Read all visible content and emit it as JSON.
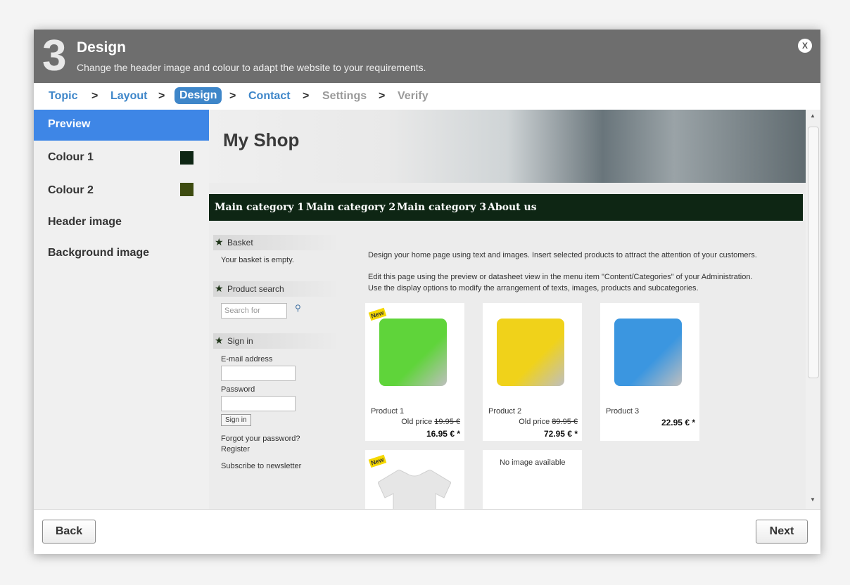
{
  "header": {
    "step_number": "3",
    "title": "Design",
    "subtitle": "Change the header image and colour to adapt the website to your requirements.",
    "close_label": "X"
  },
  "breadcrumb": {
    "steps": [
      "Topic",
      "Layout",
      "Design",
      "Contact",
      "Settings",
      "Verify"
    ],
    "separator": ">"
  },
  "sidebar": {
    "items": [
      {
        "label": "Preview",
        "active": true
      },
      {
        "label": "Colour 1",
        "swatch": "#0e2614"
      },
      {
        "label": "Colour 2",
        "swatch": "#3d4b10"
      },
      {
        "label": "Header image"
      },
      {
        "label": "Background image"
      }
    ]
  },
  "preview": {
    "shop_title": "My Shop",
    "nav": [
      "Main category 1",
      "Main category 2",
      "Main category 3",
      "About us"
    ],
    "basket": {
      "heading": "Basket",
      "text": "Your basket is empty."
    },
    "search": {
      "heading": "Product search",
      "placeholder": "Search for"
    },
    "signin": {
      "heading": "Sign in",
      "email_label": "E-mail address",
      "password_label": "Password",
      "button": "Sign in",
      "forgot": "Forgot your password?",
      "register": "Register",
      "newsletter": "Subscribe to newsletter"
    },
    "intro": "Design your home page using text and images. Insert selected products to attract the attention of your customers.",
    "edit_text_1": "Edit this page using the preview or datasheet view in the menu item \"Content/Categories\" of your Administration.",
    "edit_text_2": "Use the display options to modify the arrangement of texts, images, products and subcategories.",
    "products": [
      {
        "name": "Product 1",
        "old_price_label": "Old price",
        "old_price": "19.95 €",
        "price": "16.95 € *",
        "badge": "New",
        "color": "#5fd43a"
      },
      {
        "name": "Product 2",
        "old_price_label": "Old price",
        "old_price": "89.95 €",
        "price": "72.95 € *",
        "color": "#f0d21a"
      },
      {
        "name": "Product 3",
        "price": "22.95 € *",
        "color": "#3b96e0"
      }
    ],
    "second_row": {
      "badge": "New",
      "no_image": "No image available"
    }
  },
  "footer": {
    "back": "Back",
    "next": "Next"
  }
}
